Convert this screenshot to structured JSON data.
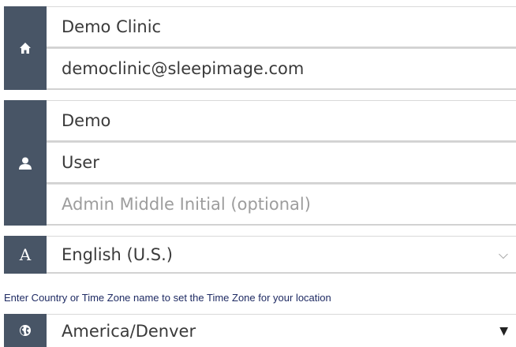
{
  "clinic": {
    "icon": "home-icon",
    "name": "Demo Clinic",
    "email": "democlinic@sleepimage.com"
  },
  "admin": {
    "icon": "user-icon",
    "first_name": "Demo",
    "last_name": "User",
    "middle_initial_placeholder": "Admin Middle Initial (optional)"
  },
  "language": {
    "icon": "language-icon",
    "icon_glyph": "A",
    "selected": "English (U.S.)"
  },
  "timezone": {
    "hint": "Enter Country or Time Zone name to set the Time Zone for your location",
    "icon": "globe-icon",
    "selected": "America/Denver"
  },
  "colors": {
    "icon_column": "#485566",
    "hint_text": "#1f2b63"
  }
}
